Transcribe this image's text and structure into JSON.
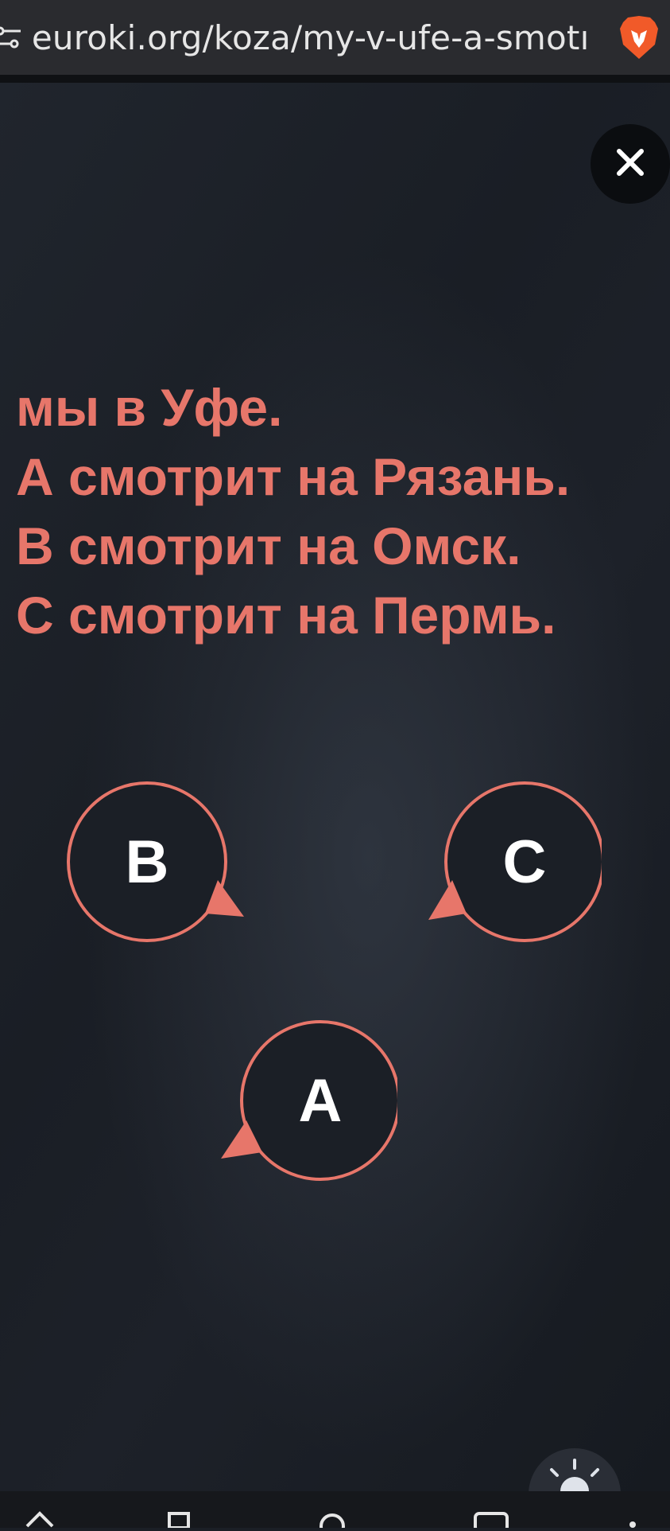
{
  "browser": {
    "url": "euroki.org/koza/my-v-ufe-a-smotı"
  },
  "riddle": {
    "lines": [
      "мы в Уфе.",
      "А смотрит на Рязань.",
      "В смотрит на Омск.",
      "С смотрит на Пермь."
    ],
    "color": "#e7766a"
  },
  "bubbles": [
    {
      "letter": "B"
    },
    {
      "letter": "C"
    },
    {
      "letter": "A"
    }
  ],
  "icons": {
    "close": "close-icon",
    "brave": "brave-lion-icon",
    "site-settings": "tune-icon",
    "hint": "lightbulb-icon"
  }
}
